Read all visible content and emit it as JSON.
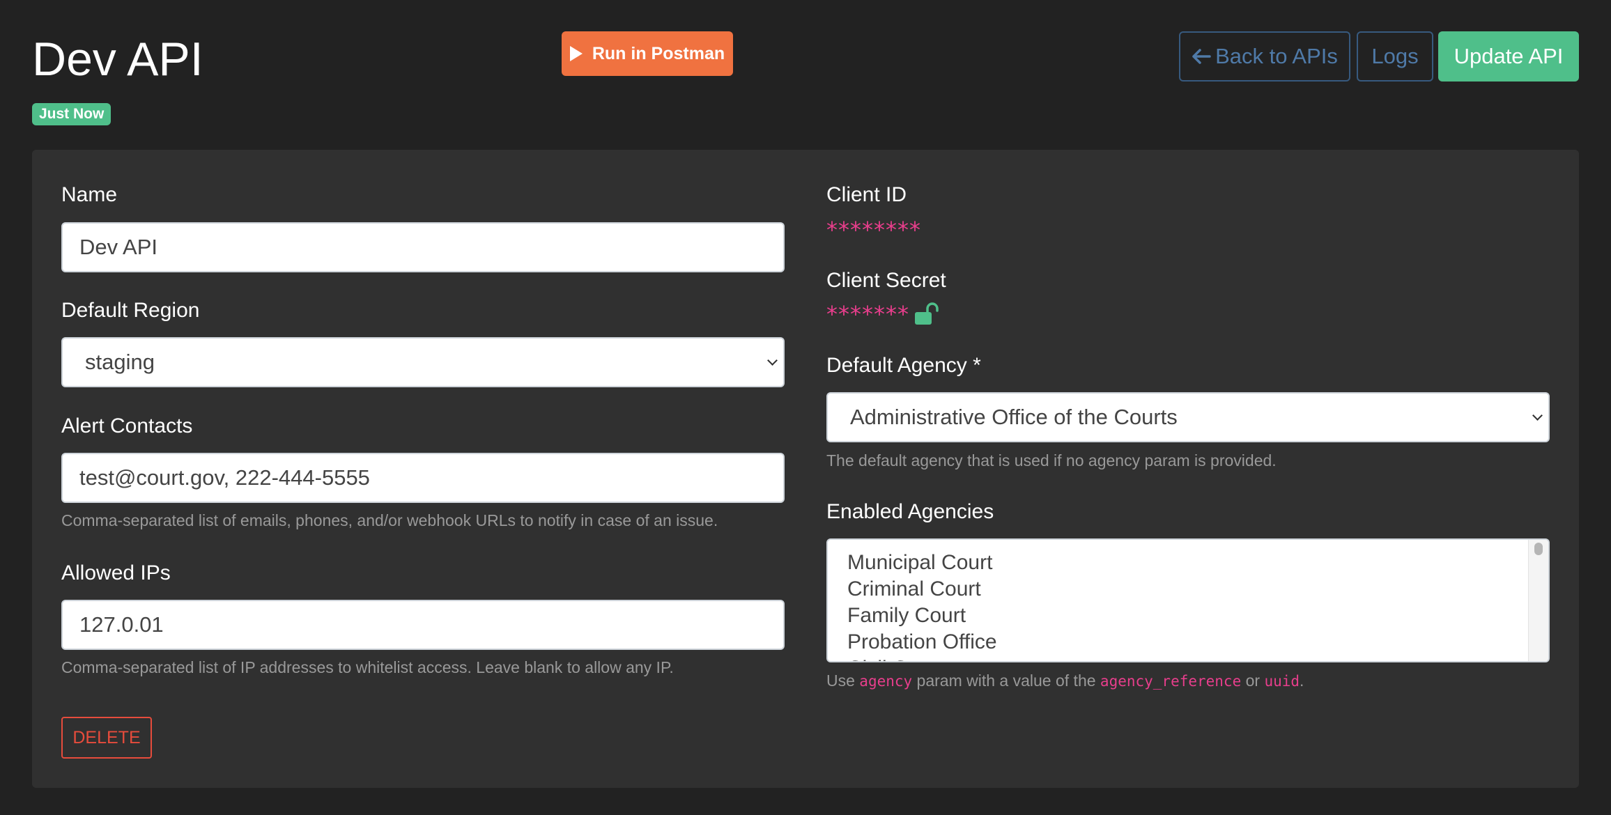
{
  "header": {
    "title": "Dev API",
    "badge": "Just Now",
    "run_postman_label": "Run in Postman",
    "back_label": "Back to APIs",
    "logs_label": "Logs",
    "update_label": "Update API"
  },
  "form": {
    "name": {
      "label": "Name",
      "value": "Dev API"
    },
    "default_region": {
      "label": "Default Region",
      "value": "staging"
    },
    "alert_contacts": {
      "label": "Alert Contacts",
      "value": "test@court.gov, 222-444-5555",
      "help": "Comma-separated list of emails, phones, and/or webhook URLs to notify in case of an issue."
    },
    "allowed_ips": {
      "label": "Allowed IPs",
      "value": "127.0.01",
      "help": "Comma-separated list of IP addresses to whitelist access. Leave blank to allow any IP."
    },
    "delete_label": "DELETE",
    "client_id": {
      "label": "Client ID",
      "value": "********"
    },
    "client_secret": {
      "label": "Client Secret",
      "value": "*******",
      "icon": "unlock-icon"
    },
    "default_agency": {
      "label": "Default Agency *",
      "value": "Administrative Office of the Courts",
      "help": "The default agency that is used if no agency param is provided."
    },
    "enabled_agencies": {
      "label": "Enabled Agencies",
      "options": [
        "Municipal Court",
        "Criminal Court",
        "Family Court",
        "Probation Office",
        "Civil Court"
      ],
      "help_prefix": "Use ",
      "help_code1": "agency",
      "help_mid1": " param with a value of the ",
      "help_code2": "agency_reference",
      "help_mid2": " or ",
      "help_code3": "uuid",
      "help_suffix": "."
    }
  },
  "colors": {
    "background": "#222222",
    "card": "#303030",
    "success": "#4fbf8a",
    "postman": "#f07240",
    "danger": "#e74c3c",
    "link": "#4f7aa8",
    "code": "#e83e8c"
  }
}
